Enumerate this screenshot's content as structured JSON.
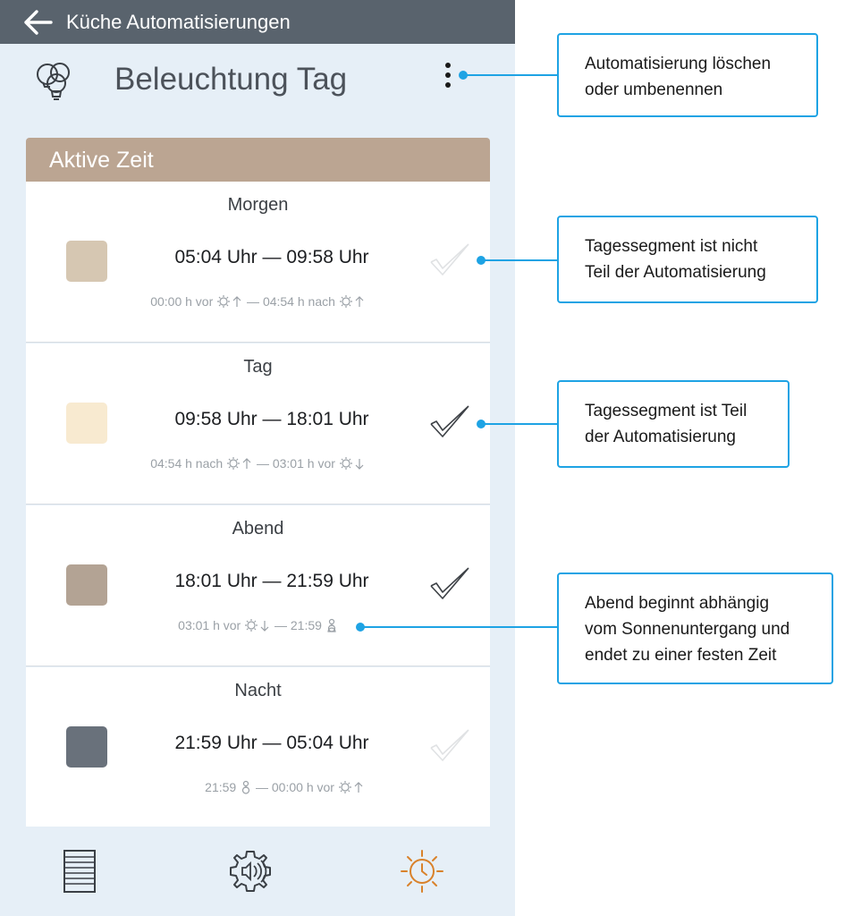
{
  "header": {
    "title": "Küche Automatisierungen"
  },
  "automation": {
    "title": "Beleuchtung Tag"
  },
  "section": {
    "title": "Aktive Zeit"
  },
  "segments": [
    {
      "name": "Morgen",
      "time": "05:04 Uhr — 09:58 Uhr",
      "rule_start": "00:00 h vor",
      "rule_mid": "—",
      "rule_end": "04:54 h nach",
      "color": "#d6c7b2",
      "included": false
    },
    {
      "name": "Tag",
      "time": "09:58 Uhr — 18:01 Uhr",
      "rule_start": "04:54 h nach",
      "rule_mid": "—",
      "rule_end": "03:01 h vor",
      "color": "#f8ead0",
      "included": true
    },
    {
      "name": "Abend",
      "time": "18:01 Uhr — 21:59 Uhr",
      "rule_start": "03:01 h vor",
      "rule_mid": "— 21:59",
      "rule_end": "",
      "color": "#b3a394",
      "included": true
    },
    {
      "name": "Nacht",
      "time": "21:59 Uhr — 05:04 Uhr",
      "rule_start": "21:59",
      "rule_mid": "— 00:00 h vor",
      "rule_end": "",
      "color": "#69717b",
      "included": false
    }
  ],
  "callouts": [
    {
      "line1": "Automatisierung löschen",
      "line2": "oder umbenennen",
      "line3": ""
    },
    {
      "line1": "Tagessegment ist nicht",
      "line2": "Teil der Automatisierung",
      "line3": ""
    },
    {
      "line1": "Tagessegment ist Teil",
      "line2": "der Automatisierung",
      "line3": ""
    },
    {
      "line1": "Abend beginnt abhängig",
      "line2": "vom Sonnenuntergang und",
      "line3": "endet zu einer festen Zeit"
    }
  ],
  "icons": {
    "back": "arrow-left-icon",
    "title": "light-bulbs-icon",
    "more": "vertical-dots-icon",
    "sun": "sun-icon",
    "clock_fixed": "pin-icon",
    "check": "checkmark-icon",
    "nav_list": "list-icon",
    "nav_settings": "gear-sound-icon",
    "nav_sun_clock": "sun-clock-icon"
  },
  "colors": {
    "topbar": "#59636d",
    "panel": "#e6eff7",
    "section_header": "#bba592",
    "callout": "#1ea3e4",
    "active_nav": "#d9822b"
  }
}
